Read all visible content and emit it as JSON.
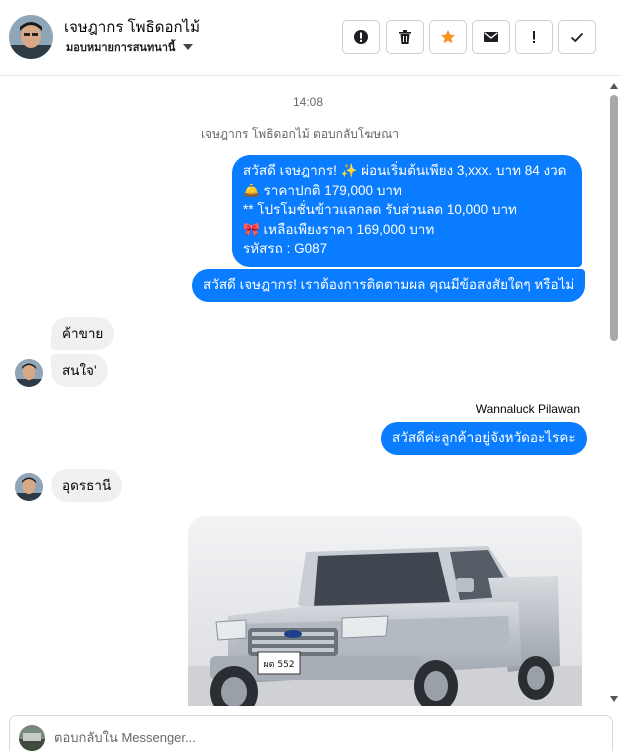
{
  "header": {
    "contact_name": "เจษฎากร โพธิดอกไม้",
    "contact_subtitle": "มอบหมายการสนทนานี้",
    "actions": [
      {
        "icon": "alert-circle-icon",
        "name": "report-button"
      },
      {
        "icon": "trash-icon",
        "name": "delete-button"
      },
      {
        "icon": "star-icon",
        "name": "star-button"
      },
      {
        "icon": "envelope-icon",
        "name": "mark-unread-button"
      },
      {
        "icon": "exclamation-icon",
        "name": "spam-button"
      },
      {
        "icon": "check-icon",
        "name": "done-button"
      }
    ],
    "colors": {
      "star": "#f7931e",
      "accent": "#0a7cff"
    }
  },
  "chat": {
    "timestamp": "14:08",
    "system_note": "เจษฎากร โพธิดอกไม้ ตอบกลับโฆษณา",
    "messages": {
      "ad_message": {
        "lines": [
          "สวัสดี เจษฎากร! ✨  ผ่อนเริ่มต้นเพียง 3,xxx. บาท 84 งวด",
          "🛎️ ราคาปกติ 179,000 บาท",
          "** โปรโมชั่นข้าวแลกลด รับส่วนลด 10,000 บาท",
          "🎀  เหลือเพียงราคา 169,000 บาท",
          " รหัสรถ : G087"
        ]
      },
      "follow_up": "สวัสดี เจษฎากร! เราต้องการติดตามผล คุณมีข้อสงสัยใดๆ หรือไม่",
      "customer_1": "ค้าขาย",
      "customer_2": "สนใจ'",
      "agent_name": "Wannaluck Pilawan",
      "agent_reply": "สวัสดีค่ะลูกค้าอยู่จังหวัดอะไรคะ",
      "customer_3": "อุดรธานี",
      "photo_plate": "ผต 552"
    }
  },
  "composer": {
    "placeholder": "ตอบกลับใน Messenger..."
  }
}
